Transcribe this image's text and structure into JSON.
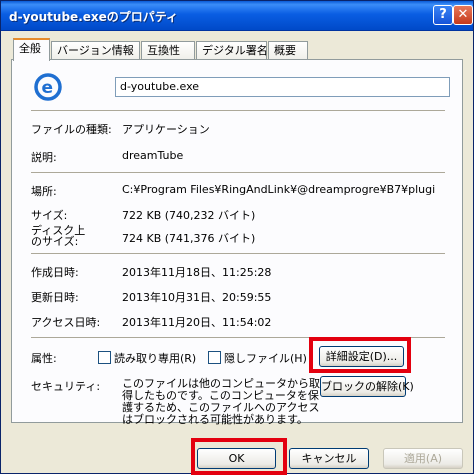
{
  "window": {
    "title": "d-youtube.exeのプロパティ",
    "help_glyph": "?",
    "close_glyph": "✕"
  },
  "tabs": [
    "全般",
    "バージョン情報",
    "互換性",
    "デジタル署名",
    "概要"
  ],
  "general": {
    "icon": "ie-e-icon",
    "file_name": "d-youtube.exe",
    "type_label": "ファイルの種類:",
    "type_value": "アプリケーション",
    "desc_label": "説明:",
    "desc_value": "dreamTube",
    "location_label": "場所:",
    "location_value": "C:¥Program Files¥RingAndLink¥@dreamprogre¥B7¥plugi",
    "size_label": "サイズ:",
    "size_value": "722 KB (740,232 バイト)",
    "disk_label": "ディスク上\nのサイズ:",
    "disk_value": "724 KB (741,376 バイト)",
    "created_label": "作成日時:",
    "created_value": "2013年11月18日、11:25:28",
    "modified_label": "更新日時:",
    "modified_value": "2013年10月31日、20:59:55",
    "accessed_label": "アクセス日時:",
    "accessed_value": "2013年11月20日、11:54:02",
    "attr_label": "属性:",
    "readonly_label": "読み取り専用(R)",
    "hidden_label": "隠しファイル(H)",
    "advanced_button": "詳細設定(D)...",
    "security_label": "セキュリティ:",
    "security_text": "このファイルは他のコンピュータから取得したものです。このコンピュータを保護するため、このファイルへのアクセスはブロックされる可能性があります。",
    "unblock_button": "ブロックの解除(K)"
  },
  "footer": {
    "ok": "OK",
    "cancel": "キャンセル",
    "apply": "適用(A)"
  },
  "colors": {
    "highlight": "#e3000f",
    "title_bar": "#0a5ee3"
  }
}
